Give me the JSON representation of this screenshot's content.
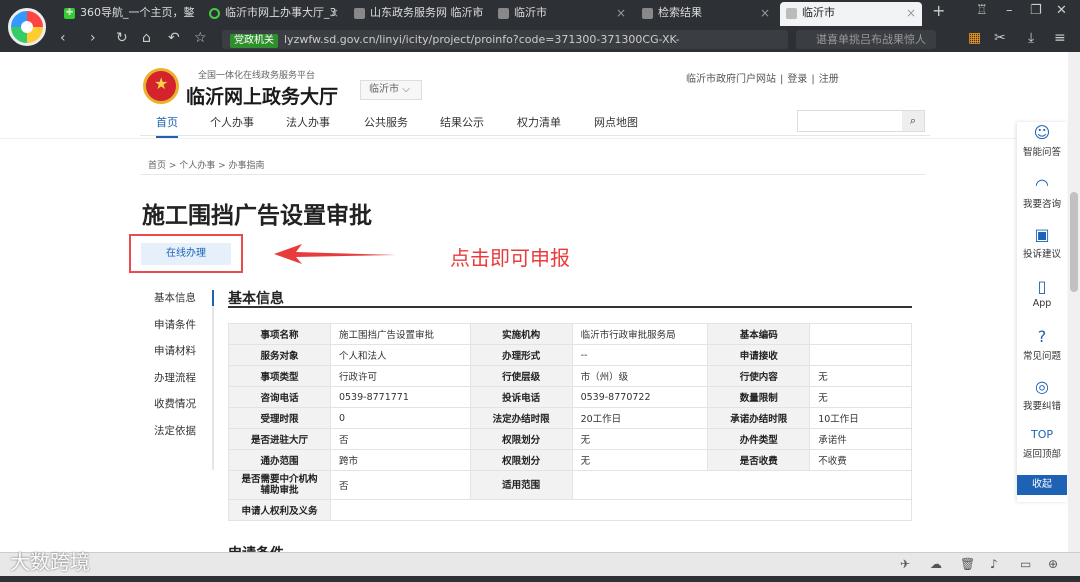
{
  "tabs": [
    {
      "title": "360导航_一个主页，整",
      "icon": "360-icon"
    },
    {
      "title": "临沂市网上办事大厅_3",
      "icon": "green-circle-icon"
    },
    {
      "title": "山东政务服务网 临沂市",
      "icon": "page-icon"
    },
    {
      "title": "临沂市",
      "icon": "page-icon"
    },
    {
      "title": "检索结果",
      "icon": "page-icon"
    },
    {
      "title": "临沂市",
      "icon": "page-icon",
      "active": true
    }
  ],
  "browser": {
    "new_tab": "+",
    "address_badge": "党政机关",
    "url": "lyzwfw.sd.gov.cn/linyi/icity/project/proinfo?code=371300-371300CG-XK-",
    "search_placeholder": "谌喜单挑吕布战果惊人"
  },
  "site": {
    "subtitle": "全国一体化在线政务服务平台",
    "title": "临沂网上政务大厅",
    "city": "临沂市",
    "links": [
      "临沂市政府门户网站",
      "登录",
      "注册"
    ]
  },
  "nav": [
    "首页",
    "个人办事",
    "法人办事",
    "公共服务",
    "结果公示",
    "权力清单",
    "网点地图"
  ],
  "breadcrumb": "首页 > 个人办事 > 办事指南",
  "item_title": "施工围挡广告设置审批",
  "online_button": "在线办理",
  "annotation": "点击即可申报",
  "side_nav": [
    "基本信息",
    "申请条件",
    "申请材料",
    "办理流程",
    "收费情况",
    "法定依据"
  ],
  "section_title": "基本信息",
  "table": [
    [
      "事项名称",
      "施工围挡广告设置审批",
      "实施机构",
      "临沂市行政审批服务局",
      "基本编码",
      ""
    ],
    [
      "服务对象",
      "个人和法人",
      "办理形式",
      "--",
      "申请接收",
      ""
    ],
    [
      "事项类型",
      "行政许可",
      "行使层级",
      "市（州）级",
      "行使内容",
      "无"
    ],
    [
      "咨询电话",
      "0539-8771771",
      "投诉电话",
      "0539-8770722",
      "数量限制",
      "无"
    ],
    [
      "受理时限",
      "0",
      "法定办结时限",
      "20工作日",
      "承诺办结时限",
      "10工作日"
    ],
    [
      "是否进驻大厅",
      "否",
      "权限划分",
      "无",
      "办件类型",
      "承诺件"
    ],
    [
      "通办范围",
      "跨市",
      "权限划分",
      "无",
      "是否收费",
      "不收费"
    ]
  ],
  "table_tall_row": [
    "是否需要中介机构辅助审批",
    "否",
    "适用范围",
    ""
  ],
  "table_last_row": [
    "申请人权利及义务",
    ""
  ],
  "next_section": "申请条件",
  "float_menu": [
    {
      "label": "智能问答",
      "icon": "robot-icon",
      "glyph": "☺"
    },
    {
      "label": "我要咨询",
      "icon": "headset-icon",
      "glyph": "◠"
    },
    {
      "label": "投诉建议",
      "icon": "message-icon",
      "glyph": "▣"
    },
    {
      "label": "App",
      "icon": "phone-icon",
      "glyph": "▯"
    },
    {
      "label": "常见问题",
      "icon": "question-icon",
      "glyph": "?"
    },
    {
      "label": "我要纠错",
      "icon": "error-icon",
      "glyph": "◎"
    },
    {
      "label": "返回顶部",
      "icon": "top-icon",
      "glyph": "TOP"
    }
  ],
  "collapse": "收起",
  "watermark": "大数跨境"
}
